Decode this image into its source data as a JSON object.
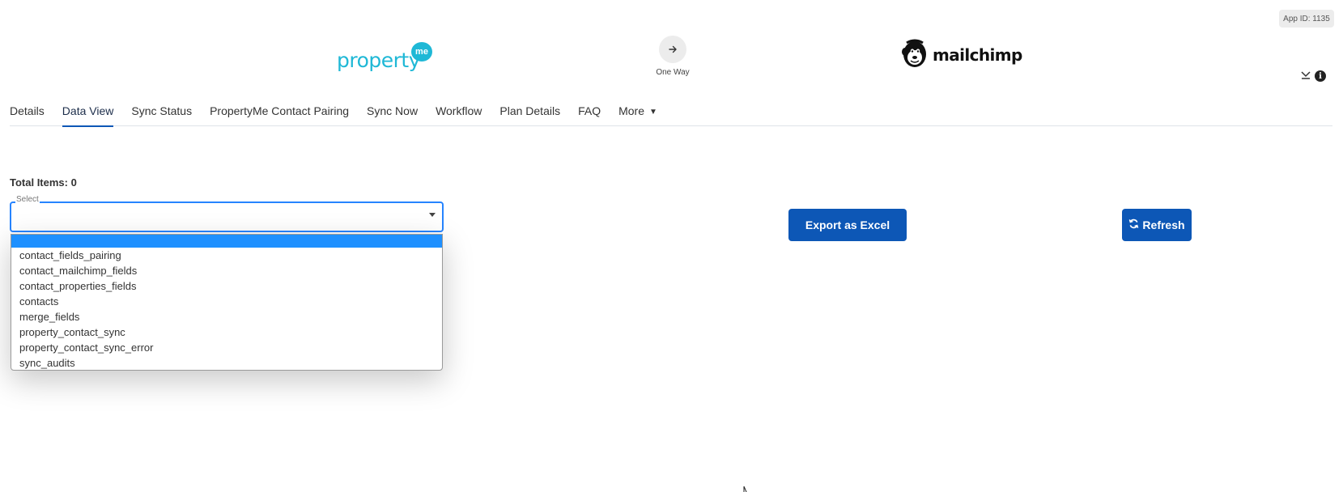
{
  "header": {
    "app_id": "App ID: 1135",
    "left_brand": {
      "name": "property",
      "badge": "me",
      "color": "#1fb8d6"
    },
    "sync_direction": {
      "label": "One Way",
      "icon": "arrow-right-icon"
    },
    "right_brand": {
      "name": "mailchimp",
      "icon": "mailchimp-monkey-icon"
    },
    "icons": [
      "collapse-down-icon",
      "info-icon"
    ],
    "info_glyph": "i"
  },
  "tabs": [
    {
      "label": "Details",
      "active": false
    },
    {
      "label": "Data View",
      "active": true
    },
    {
      "label": "Sync Status",
      "active": false
    },
    {
      "label": "PropertyMe Contact Pairing",
      "active": false
    },
    {
      "label": "Sync Now",
      "active": false
    },
    {
      "label": "Workflow",
      "active": false
    },
    {
      "label": "Plan Details",
      "active": false
    },
    {
      "label": "FAQ",
      "active": false
    },
    {
      "label": "More",
      "active": false
    }
  ],
  "data_view": {
    "total_items": "Total Items: 0",
    "select": {
      "legend": "Select",
      "value": "",
      "options": [
        "",
        "contact_fields_pairing",
        "contact_mailchimp_fields",
        "contact_properties_fields",
        "contacts",
        "merge_fields",
        "property_contact_sync",
        "property_contact_sync_error",
        "sync_audits"
      ]
    },
    "export_label": "Export as Excel",
    "refresh_label": "Refresh"
  },
  "colors": {
    "accent": "#0d57b6",
    "focus": "#2684ff",
    "highlight": "#1e90ff",
    "propertyme": "#1fb8d6"
  }
}
